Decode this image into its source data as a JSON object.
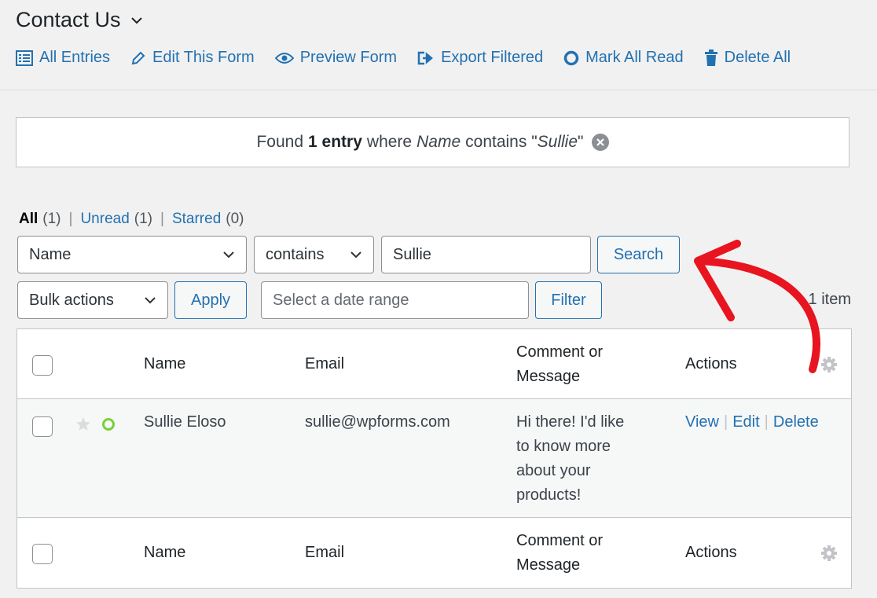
{
  "header": {
    "title": "Contact Us",
    "toolbar": [
      {
        "label": "All Entries",
        "icon": "list-icon"
      },
      {
        "label": "Edit This Form",
        "icon": "pencil-icon"
      },
      {
        "label": "Preview Form",
        "icon": "eye-icon"
      },
      {
        "label": "Export Filtered",
        "icon": "export-icon"
      },
      {
        "label": "Mark All Read",
        "icon": "circle-icon"
      },
      {
        "label": "Delete All",
        "icon": "trash-icon"
      }
    ]
  },
  "notice": {
    "prefix": "Found",
    "count_text": "1 entry",
    "middle": "where",
    "field": "Name",
    "operator_text": "contains \"",
    "term": "Sullie",
    "suffix": "\""
  },
  "views": {
    "all_label": "All",
    "all_count": "(1)",
    "unread_label": "Unread",
    "unread_count": "(1)",
    "starred_label": "Starred",
    "starred_count": "(0)"
  },
  "filters": {
    "field_select": "Name",
    "operator_select": "contains",
    "search_value": "Sullie",
    "search_button": "Search",
    "bulk_select": "Bulk actions",
    "apply_button": "Apply",
    "date_placeholder": "Select a date range",
    "filter_button": "Filter",
    "item_count": "1 item"
  },
  "table": {
    "columns": {
      "name": "Name",
      "email": "Email",
      "message_line1": "Comment or",
      "message_line2": "Message",
      "actions": "Actions"
    },
    "rows": [
      {
        "name": "Sullie Eloso",
        "email": "sullie@wpforms.com",
        "message_lines": [
          "Hi there! I'd like",
          "to know more",
          "about your",
          "products!"
        ],
        "action_view": "View",
        "action_edit": "Edit",
        "action_delete": "Delete",
        "separator": "|"
      }
    ]
  },
  "colors": {
    "link": "#2271b1",
    "annotation_arrow": "#e8141f",
    "unread_dot": "#7ad03a"
  }
}
